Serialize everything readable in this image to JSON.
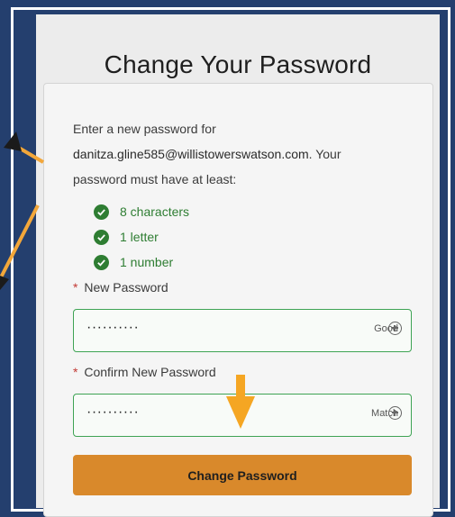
{
  "page": {
    "title": "Change Your Password"
  },
  "form": {
    "intro_line1": "Enter a new password for",
    "email": "danitza.gline585@willistowerswatson.com",
    "intro_suffix": ". Your",
    "intro_line3": "password must have at least:",
    "requirements": [
      "8 characters",
      "1 letter",
      "1 number"
    ],
    "new_password": {
      "required_mark": "*",
      "label": "New Password",
      "value": "··········",
      "strength": "Good"
    },
    "confirm_password": {
      "required_mark": "*",
      "label": "Confirm New Password",
      "value": "··········",
      "status": "Match"
    },
    "submit_label": "Change Password"
  },
  "colors": {
    "background": "#243f6e",
    "accent": "#d9892b",
    "success": "#2e7d32",
    "input_border": "#3ea354"
  }
}
